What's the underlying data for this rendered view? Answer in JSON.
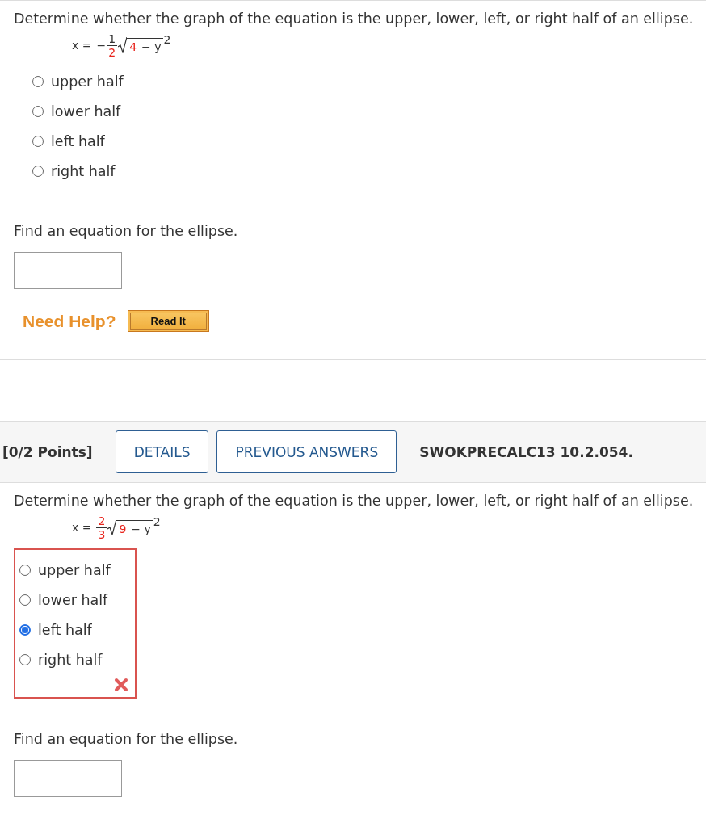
{
  "question_1": {
    "prompt": "Determine whether the graph of the equation is the upper, lower, left, or right half of an ellipse.",
    "equation": {
      "lhs": "x =",
      "sign": "−",
      "numerator": {
        "text": "1",
        "highlighted": false
      },
      "denominator": {
        "text": "2",
        "highlighted": true
      },
      "radicand_number": {
        "text": "4",
        "highlighted": true
      },
      "radicand_rest": "− y",
      "exponent": "2"
    },
    "options": [
      {
        "label": "upper half",
        "selected": false
      },
      {
        "label": "lower half",
        "selected": false
      },
      {
        "label": "left half",
        "selected": false
      },
      {
        "label": "right half",
        "selected": false
      }
    ],
    "find_prompt": "Find an equation for the ellipse.",
    "help": {
      "label": "Need Help?",
      "button": "Read It"
    }
  },
  "question_2_header": {
    "points": "[0/2 Points]",
    "buttons": [
      "DETAILS",
      "PREVIOUS ANSWERS"
    ],
    "code": "SWOKPRECALC13 10.2.054."
  },
  "question_2": {
    "prompt": "Determine whether the graph of the equation is the upper, lower, left, or right half of an ellipse.",
    "equation": {
      "lhs": "x =",
      "numerator": {
        "text": "2",
        "highlighted": true
      },
      "denominator": {
        "text": "3",
        "highlighted": true
      },
      "radicand_number": {
        "text": "9",
        "highlighted": true
      },
      "radicand_rest": "− y",
      "exponent": "2"
    },
    "options": [
      {
        "label": "upper half",
        "selected": false
      },
      {
        "label": "lower half",
        "selected": false
      },
      {
        "label": "left half",
        "selected": true
      },
      {
        "label": "right half",
        "selected": false
      }
    ],
    "incorrect": true,
    "find_prompt": "Find an equation for the ellipse."
  }
}
